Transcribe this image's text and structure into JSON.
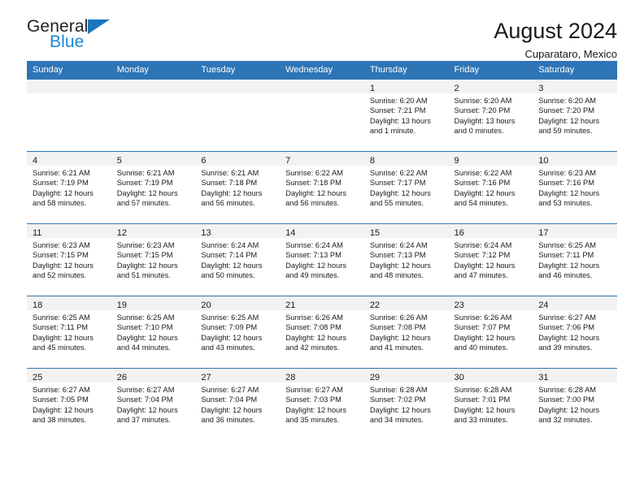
{
  "brand": {
    "name_part1": "General",
    "name_part2": "Blue",
    "triangle_color": "#1b75bb",
    "blue_text_color": "#1b86d8"
  },
  "header": {
    "title": "August 2024",
    "subtitle": "Cuparataro, Mexico",
    "header_bg_color": "#2e75b6",
    "daynum_band_color": "#f2f2f2"
  },
  "weekdays": [
    "Sunday",
    "Monday",
    "Tuesday",
    "Wednesday",
    "Thursday",
    "Friday",
    "Saturday"
  ],
  "weeks": [
    [
      {
        "day": "",
        "sunrise": "",
        "sunset": "",
        "daylight1": "",
        "daylight2": ""
      },
      {
        "day": "",
        "sunrise": "",
        "sunset": "",
        "daylight1": "",
        "daylight2": ""
      },
      {
        "day": "",
        "sunrise": "",
        "sunset": "",
        "daylight1": "",
        "daylight2": ""
      },
      {
        "day": "",
        "sunrise": "",
        "sunset": "",
        "daylight1": "",
        "daylight2": ""
      },
      {
        "day": "1",
        "sunrise": "Sunrise: 6:20 AM",
        "sunset": "Sunset: 7:21 PM",
        "daylight1": "Daylight: 13 hours",
        "daylight2": "and 1 minute."
      },
      {
        "day": "2",
        "sunrise": "Sunrise: 6:20 AM",
        "sunset": "Sunset: 7:20 PM",
        "daylight1": "Daylight: 13 hours",
        "daylight2": "and 0 minutes."
      },
      {
        "day": "3",
        "sunrise": "Sunrise: 6:20 AM",
        "sunset": "Sunset: 7:20 PM",
        "daylight1": "Daylight: 12 hours",
        "daylight2": "and 59 minutes."
      }
    ],
    [
      {
        "day": "4",
        "sunrise": "Sunrise: 6:21 AM",
        "sunset": "Sunset: 7:19 PM",
        "daylight1": "Daylight: 12 hours",
        "daylight2": "and 58 minutes."
      },
      {
        "day": "5",
        "sunrise": "Sunrise: 6:21 AM",
        "sunset": "Sunset: 7:19 PM",
        "daylight1": "Daylight: 12 hours",
        "daylight2": "and 57 minutes."
      },
      {
        "day": "6",
        "sunrise": "Sunrise: 6:21 AM",
        "sunset": "Sunset: 7:18 PM",
        "daylight1": "Daylight: 12 hours",
        "daylight2": "and 56 minutes."
      },
      {
        "day": "7",
        "sunrise": "Sunrise: 6:22 AM",
        "sunset": "Sunset: 7:18 PM",
        "daylight1": "Daylight: 12 hours",
        "daylight2": "and 56 minutes."
      },
      {
        "day": "8",
        "sunrise": "Sunrise: 6:22 AM",
        "sunset": "Sunset: 7:17 PM",
        "daylight1": "Daylight: 12 hours",
        "daylight2": "and 55 minutes."
      },
      {
        "day": "9",
        "sunrise": "Sunrise: 6:22 AM",
        "sunset": "Sunset: 7:16 PM",
        "daylight1": "Daylight: 12 hours",
        "daylight2": "and 54 minutes."
      },
      {
        "day": "10",
        "sunrise": "Sunrise: 6:23 AM",
        "sunset": "Sunset: 7:16 PM",
        "daylight1": "Daylight: 12 hours",
        "daylight2": "and 53 minutes."
      }
    ],
    [
      {
        "day": "11",
        "sunrise": "Sunrise: 6:23 AM",
        "sunset": "Sunset: 7:15 PM",
        "daylight1": "Daylight: 12 hours",
        "daylight2": "and 52 minutes."
      },
      {
        "day": "12",
        "sunrise": "Sunrise: 6:23 AM",
        "sunset": "Sunset: 7:15 PM",
        "daylight1": "Daylight: 12 hours",
        "daylight2": "and 51 minutes."
      },
      {
        "day": "13",
        "sunrise": "Sunrise: 6:24 AM",
        "sunset": "Sunset: 7:14 PM",
        "daylight1": "Daylight: 12 hours",
        "daylight2": "and 50 minutes."
      },
      {
        "day": "14",
        "sunrise": "Sunrise: 6:24 AM",
        "sunset": "Sunset: 7:13 PM",
        "daylight1": "Daylight: 12 hours",
        "daylight2": "and 49 minutes."
      },
      {
        "day": "15",
        "sunrise": "Sunrise: 6:24 AM",
        "sunset": "Sunset: 7:13 PM",
        "daylight1": "Daylight: 12 hours",
        "daylight2": "and 48 minutes."
      },
      {
        "day": "16",
        "sunrise": "Sunrise: 6:24 AM",
        "sunset": "Sunset: 7:12 PM",
        "daylight1": "Daylight: 12 hours",
        "daylight2": "and 47 minutes."
      },
      {
        "day": "17",
        "sunrise": "Sunrise: 6:25 AM",
        "sunset": "Sunset: 7:11 PM",
        "daylight1": "Daylight: 12 hours",
        "daylight2": "and 46 minutes."
      }
    ],
    [
      {
        "day": "18",
        "sunrise": "Sunrise: 6:25 AM",
        "sunset": "Sunset: 7:11 PM",
        "daylight1": "Daylight: 12 hours",
        "daylight2": "and 45 minutes."
      },
      {
        "day": "19",
        "sunrise": "Sunrise: 6:25 AM",
        "sunset": "Sunset: 7:10 PM",
        "daylight1": "Daylight: 12 hours",
        "daylight2": "and 44 minutes."
      },
      {
        "day": "20",
        "sunrise": "Sunrise: 6:25 AM",
        "sunset": "Sunset: 7:09 PM",
        "daylight1": "Daylight: 12 hours",
        "daylight2": "and 43 minutes."
      },
      {
        "day": "21",
        "sunrise": "Sunrise: 6:26 AM",
        "sunset": "Sunset: 7:08 PM",
        "daylight1": "Daylight: 12 hours",
        "daylight2": "and 42 minutes."
      },
      {
        "day": "22",
        "sunrise": "Sunrise: 6:26 AM",
        "sunset": "Sunset: 7:08 PM",
        "daylight1": "Daylight: 12 hours",
        "daylight2": "and 41 minutes."
      },
      {
        "day": "23",
        "sunrise": "Sunrise: 6:26 AM",
        "sunset": "Sunset: 7:07 PM",
        "daylight1": "Daylight: 12 hours",
        "daylight2": "and 40 minutes."
      },
      {
        "day": "24",
        "sunrise": "Sunrise: 6:27 AM",
        "sunset": "Sunset: 7:06 PM",
        "daylight1": "Daylight: 12 hours",
        "daylight2": "and 39 minutes."
      }
    ],
    [
      {
        "day": "25",
        "sunrise": "Sunrise: 6:27 AM",
        "sunset": "Sunset: 7:05 PM",
        "daylight1": "Daylight: 12 hours",
        "daylight2": "and 38 minutes."
      },
      {
        "day": "26",
        "sunrise": "Sunrise: 6:27 AM",
        "sunset": "Sunset: 7:04 PM",
        "daylight1": "Daylight: 12 hours",
        "daylight2": "and 37 minutes."
      },
      {
        "day": "27",
        "sunrise": "Sunrise: 6:27 AM",
        "sunset": "Sunset: 7:04 PM",
        "daylight1": "Daylight: 12 hours",
        "daylight2": "and 36 minutes."
      },
      {
        "day": "28",
        "sunrise": "Sunrise: 6:27 AM",
        "sunset": "Sunset: 7:03 PM",
        "daylight1": "Daylight: 12 hours",
        "daylight2": "and 35 minutes."
      },
      {
        "day": "29",
        "sunrise": "Sunrise: 6:28 AM",
        "sunset": "Sunset: 7:02 PM",
        "daylight1": "Daylight: 12 hours",
        "daylight2": "and 34 minutes."
      },
      {
        "day": "30",
        "sunrise": "Sunrise: 6:28 AM",
        "sunset": "Sunset: 7:01 PM",
        "daylight1": "Daylight: 12 hours",
        "daylight2": "and 33 minutes."
      },
      {
        "day": "31",
        "sunrise": "Sunrise: 6:28 AM",
        "sunset": "Sunset: 7:00 PM",
        "daylight1": "Daylight: 12 hours",
        "daylight2": "and 32 minutes."
      }
    ]
  ]
}
